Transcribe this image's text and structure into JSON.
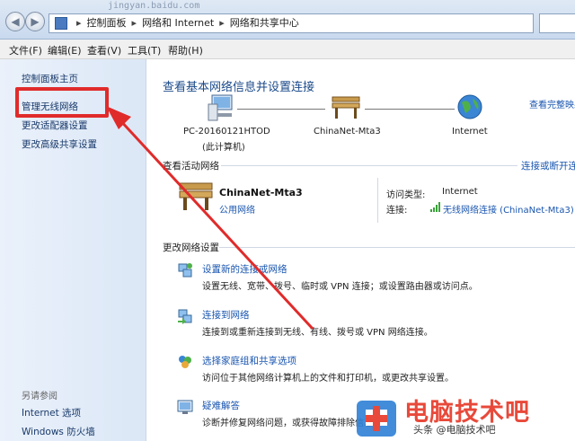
{
  "window": {
    "breadcrumb": [
      "控制面板",
      "网络和 Internet",
      "网络和共享中心"
    ],
    "url_ghost": "jingyan.baidu.com"
  },
  "menus": [
    "文件(F)",
    "编辑(E)",
    "查看(V)",
    "工具(T)",
    "帮助(H)"
  ],
  "sidebar": {
    "items": [
      {
        "label": "控制面板主页"
      },
      {
        "label": "管理无线网络"
      },
      {
        "label": "更改适配器设置"
      },
      {
        "label": "更改高级共享设置"
      }
    ],
    "see_also_title": "另请参阅",
    "see_also": [
      {
        "label": "Internet 选项"
      },
      {
        "label": "Windows 防火墙"
      }
    ]
  },
  "main": {
    "heading": "查看基本网络信息并设置连接",
    "full_map_link": "查看完整映射",
    "map": {
      "computer": "PC-20160121HTOD",
      "computer_sub": "(此计算机)",
      "network": "ChinaNet-Mta3",
      "internet": "Internet"
    },
    "active_title": "查看活动网络",
    "connect_link": "连接或断开连接",
    "active": {
      "name": "ChinaNet-Mta3",
      "type": "公用网络",
      "access_label": "访问类型:",
      "access_value": "Internet",
      "conn_label": "连接:",
      "conn_value": "无线网络连接 (ChinaNet-Mta3)"
    },
    "change_title": "更改网络设置",
    "tasks": [
      {
        "title": "设置新的连接或网络",
        "desc": "设置无线、宽带、拨号、临时或 VPN 连接；或设置路由器或访问点。"
      },
      {
        "title": "连接到网络",
        "desc": "连接到或重新连接到无线、有线、拨号或 VPN 网络连接。"
      },
      {
        "title": "选择家庭组和共享选项",
        "desc": "访问位于其他网络计算机上的文件和打印机，或更改共享设置。"
      },
      {
        "title": "疑难解答",
        "desc": "诊断并修复网络问题，或获得故障排除信息。"
      }
    ]
  },
  "watermark": {
    "text": "电脑技术吧",
    "sub": "头条 @电脑技术吧"
  },
  "colors": {
    "highlight": "#e02b2b",
    "arrow": "#e02b2b",
    "link": "#1a56b0"
  }
}
